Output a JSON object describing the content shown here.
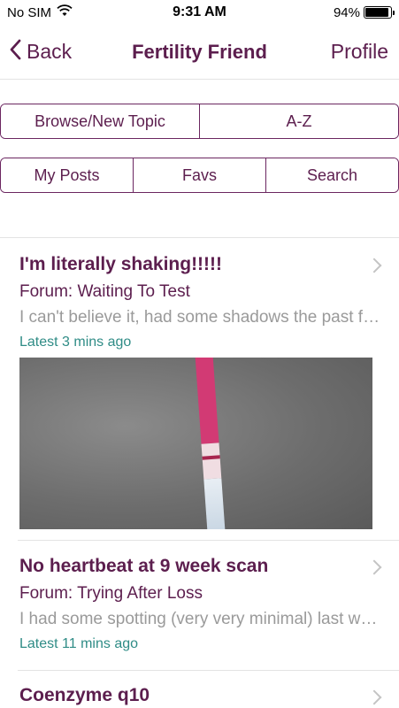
{
  "status_bar": {
    "carrier": "No SIM",
    "time": "9:31 AM",
    "battery": "94%",
    "battery_level": 0.94
  },
  "nav": {
    "back_label": "Back",
    "title": "Fertility Friend",
    "profile_label": "Profile"
  },
  "segments_row1": [
    "Browse/New Topic",
    "A-Z"
  ],
  "segments_row2": [
    "My Posts",
    "Favs",
    "Search"
  ],
  "posts": [
    {
      "title": "I'm literally shaking!!!!!",
      "forum": "Forum: Waiting To Test",
      "snippet": "I can't believe it, had some shadows the past few days",
      "latest": "Latest 3 mins ago",
      "has_image": true
    },
    {
      "title": "No heartbeat at 9 week scan",
      "forum": "Forum: Trying After Loss",
      "snippet": "I had some spotting (very very minimal) last week",
      "latest": "Latest 11 mins ago",
      "has_image": false
    },
    {
      "title": "Coenzyme q10",
      "forum": "",
      "snippet": "",
      "latest": "",
      "has_image": false
    }
  ],
  "colors": {
    "brand": "#5c1e4e",
    "latest": "#2f8c86",
    "snippet": "#9a9a9a"
  }
}
